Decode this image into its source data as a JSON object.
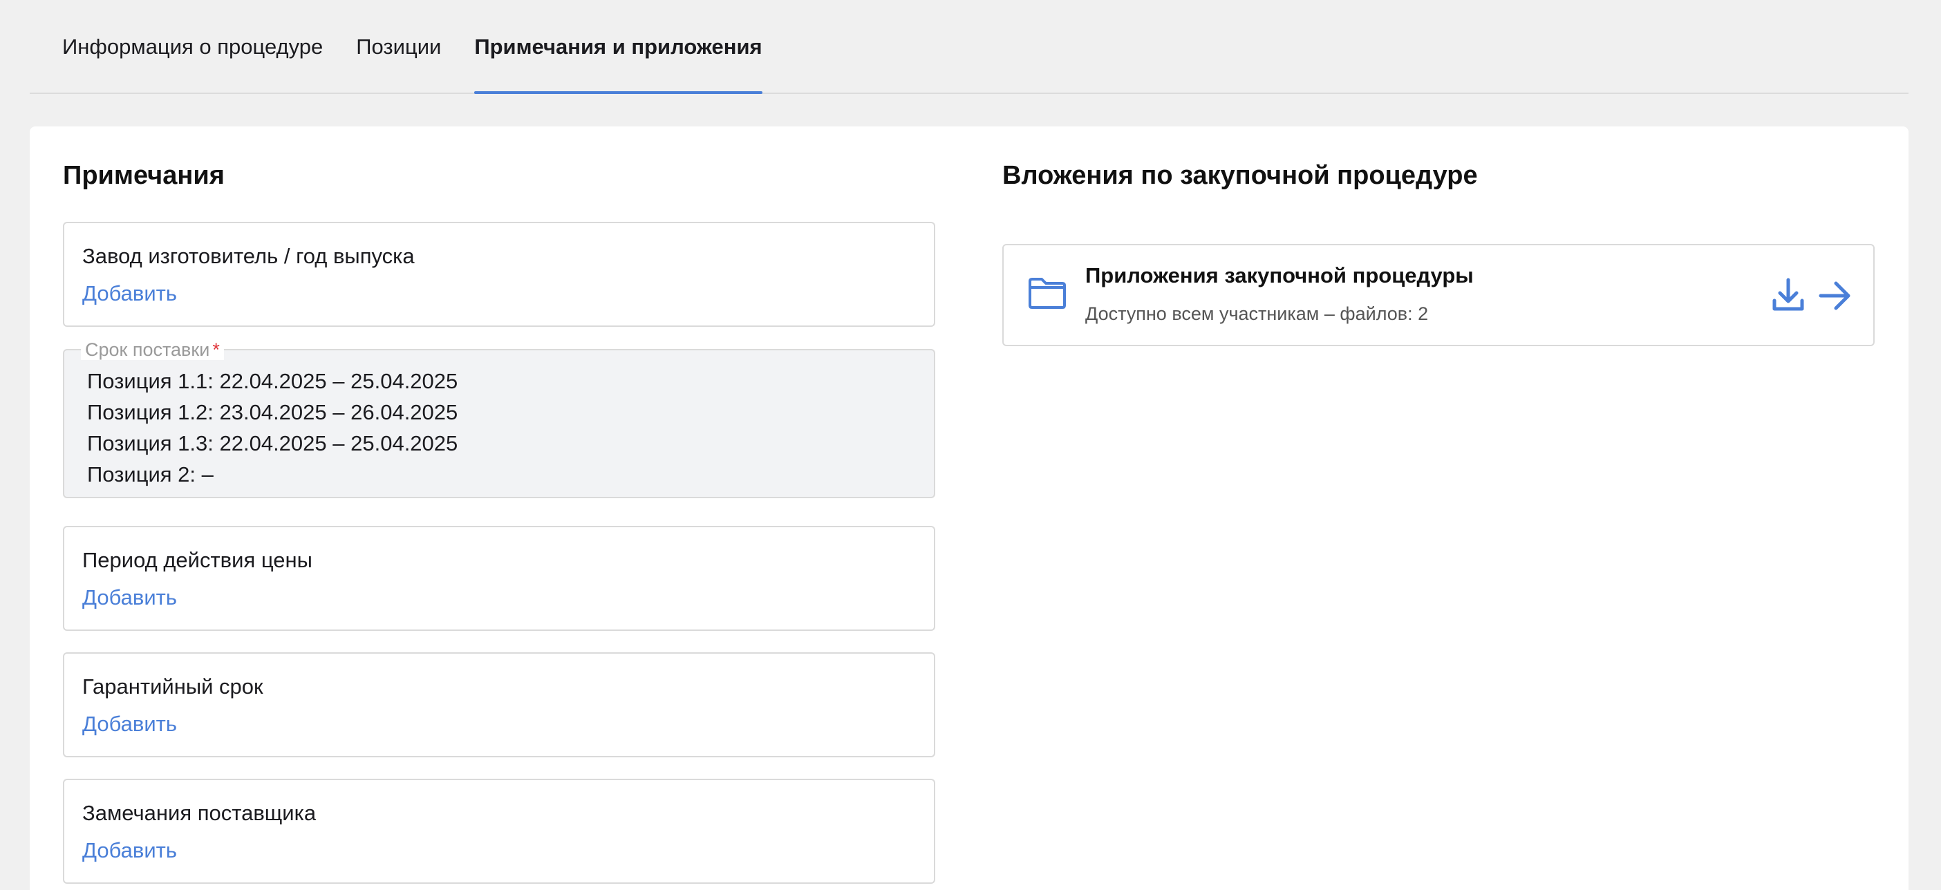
{
  "tabs": [
    {
      "label": "Информация о процедуре",
      "active": false
    },
    {
      "label": "Позиции",
      "active": false
    },
    {
      "label": "Примечания и приложения",
      "active": true
    }
  ],
  "notes": {
    "title": "Примечания",
    "add_label": "Добавить",
    "fields": [
      {
        "label": "Завод изготовитель / год выпуска"
      },
      {
        "label": "Период действия цены"
      },
      {
        "label": "Гарантийный срок"
      },
      {
        "label": "Замечания поставщика"
      }
    ],
    "delivery": {
      "legend": "Срок поставки",
      "required_mark": "*",
      "lines": [
        "Позиция 1.1: 22.04.2025 – 25.04.2025",
        "Позиция 1.2: 23.04.2025 – 26.04.2025",
        "Позиция 1.3: 22.04.2025 – 25.04.2025",
        "Позиция 2: –"
      ]
    }
  },
  "attachments": {
    "title": "Вложения по закупочной процедуре",
    "item": {
      "title": "Приложения закупочной процедуры",
      "subtitle": "Доступно всем участникам – файлов: 2",
      "icon": "folder-icon"
    }
  },
  "colors": {
    "accent": "#4a7fd8",
    "required": "#e0363b",
    "border": "#dadada",
    "background": "#f0f0f0"
  }
}
